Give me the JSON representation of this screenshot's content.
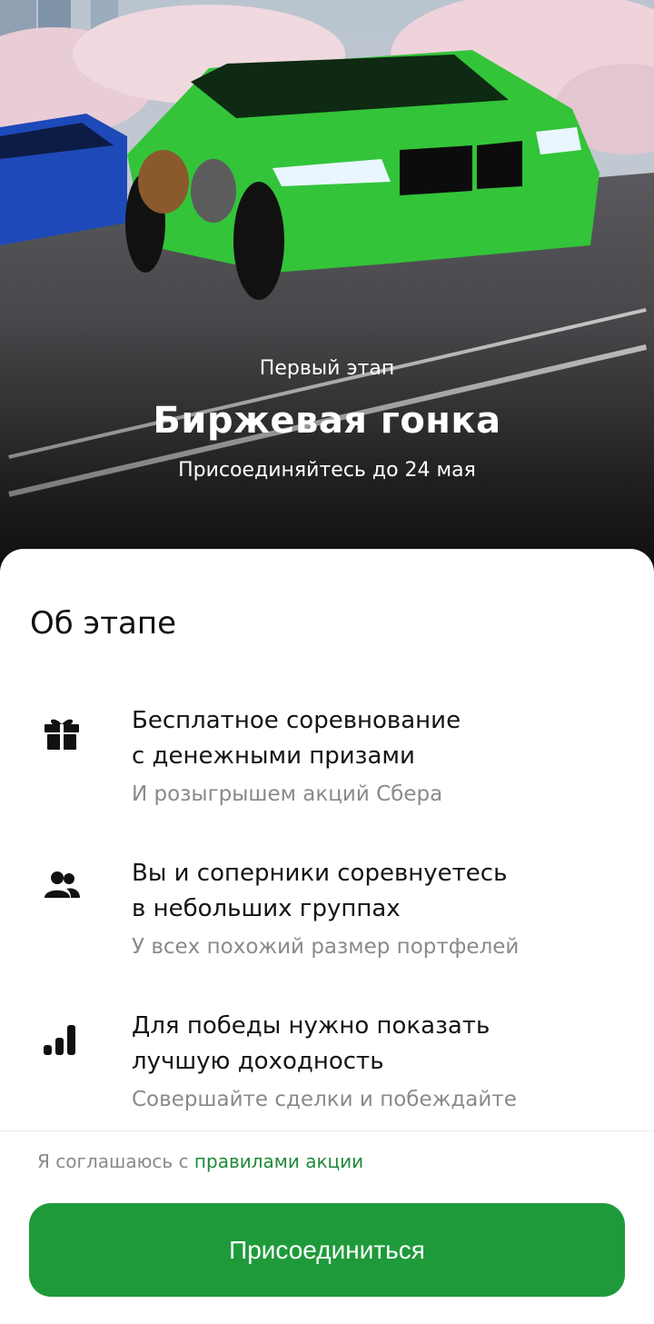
{
  "hero": {
    "eyebrow": "Первый этап",
    "title": "Биржевая гонка",
    "subtitle": "Присоединяйтесь до 24 мая"
  },
  "about": {
    "title": "Об этапе",
    "features": [
      {
        "icon": "gift-icon",
        "title_line1": "Бесплатное соревнование",
        "title_line2": "с денежными призами",
        "subtitle": "И розыгрышем акций Сбера"
      },
      {
        "icon": "users-icon",
        "title_line1": "Вы и соперники соревнуетесь",
        "title_line2": "в небольших группах",
        "subtitle": "У всех похожий размер портфелей"
      },
      {
        "icon": "bar-chart-icon",
        "title_line1": "Для победы нужно показать",
        "title_line2": "лучшую доходность",
        "subtitle": "Совершайте сделки и побеждайте"
      }
    ]
  },
  "footer": {
    "agree_prefix": "Я соглашаюсь с ",
    "agree_link": "правилами акции",
    "join_label": "Присоединиться"
  },
  "colors": {
    "accent": "#1f9a3a",
    "link": "#1f8a3a",
    "muted": "#8a8a8a"
  }
}
